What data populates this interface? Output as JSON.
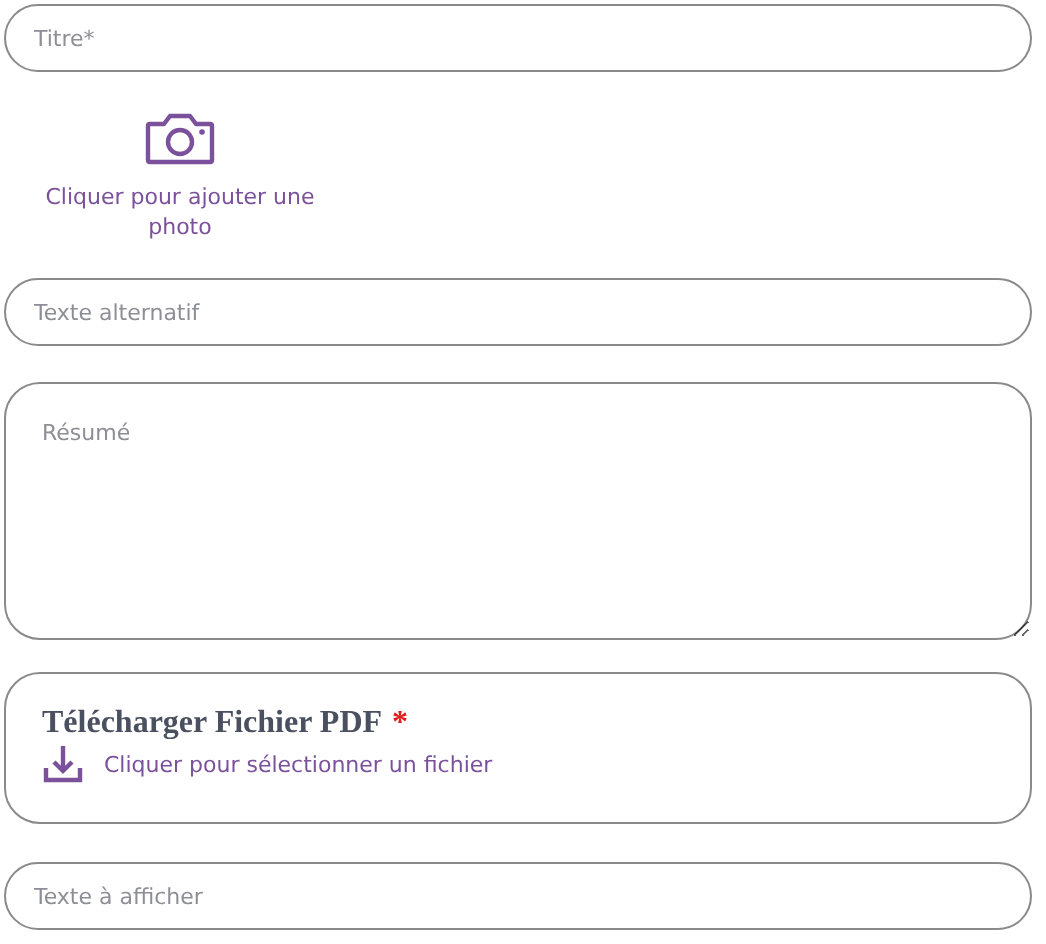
{
  "title_field": {
    "placeholder": "Titre*"
  },
  "photo_upload": {
    "label": "Cliquer pour ajouter une photo"
  },
  "alt_text_field": {
    "placeholder": "Texte alternatif"
  },
  "summary_field": {
    "placeholder": "Résumé"
  },
  "pdf_upload": {
    "title": "Télécharger Fichier PDF",
    "required_mark": "*",
    "link": "Cliquer pour sélectionner un fichier"
  },
  "display_text_field": {
    "placeholder": "Texte à afficher"
  }
}
